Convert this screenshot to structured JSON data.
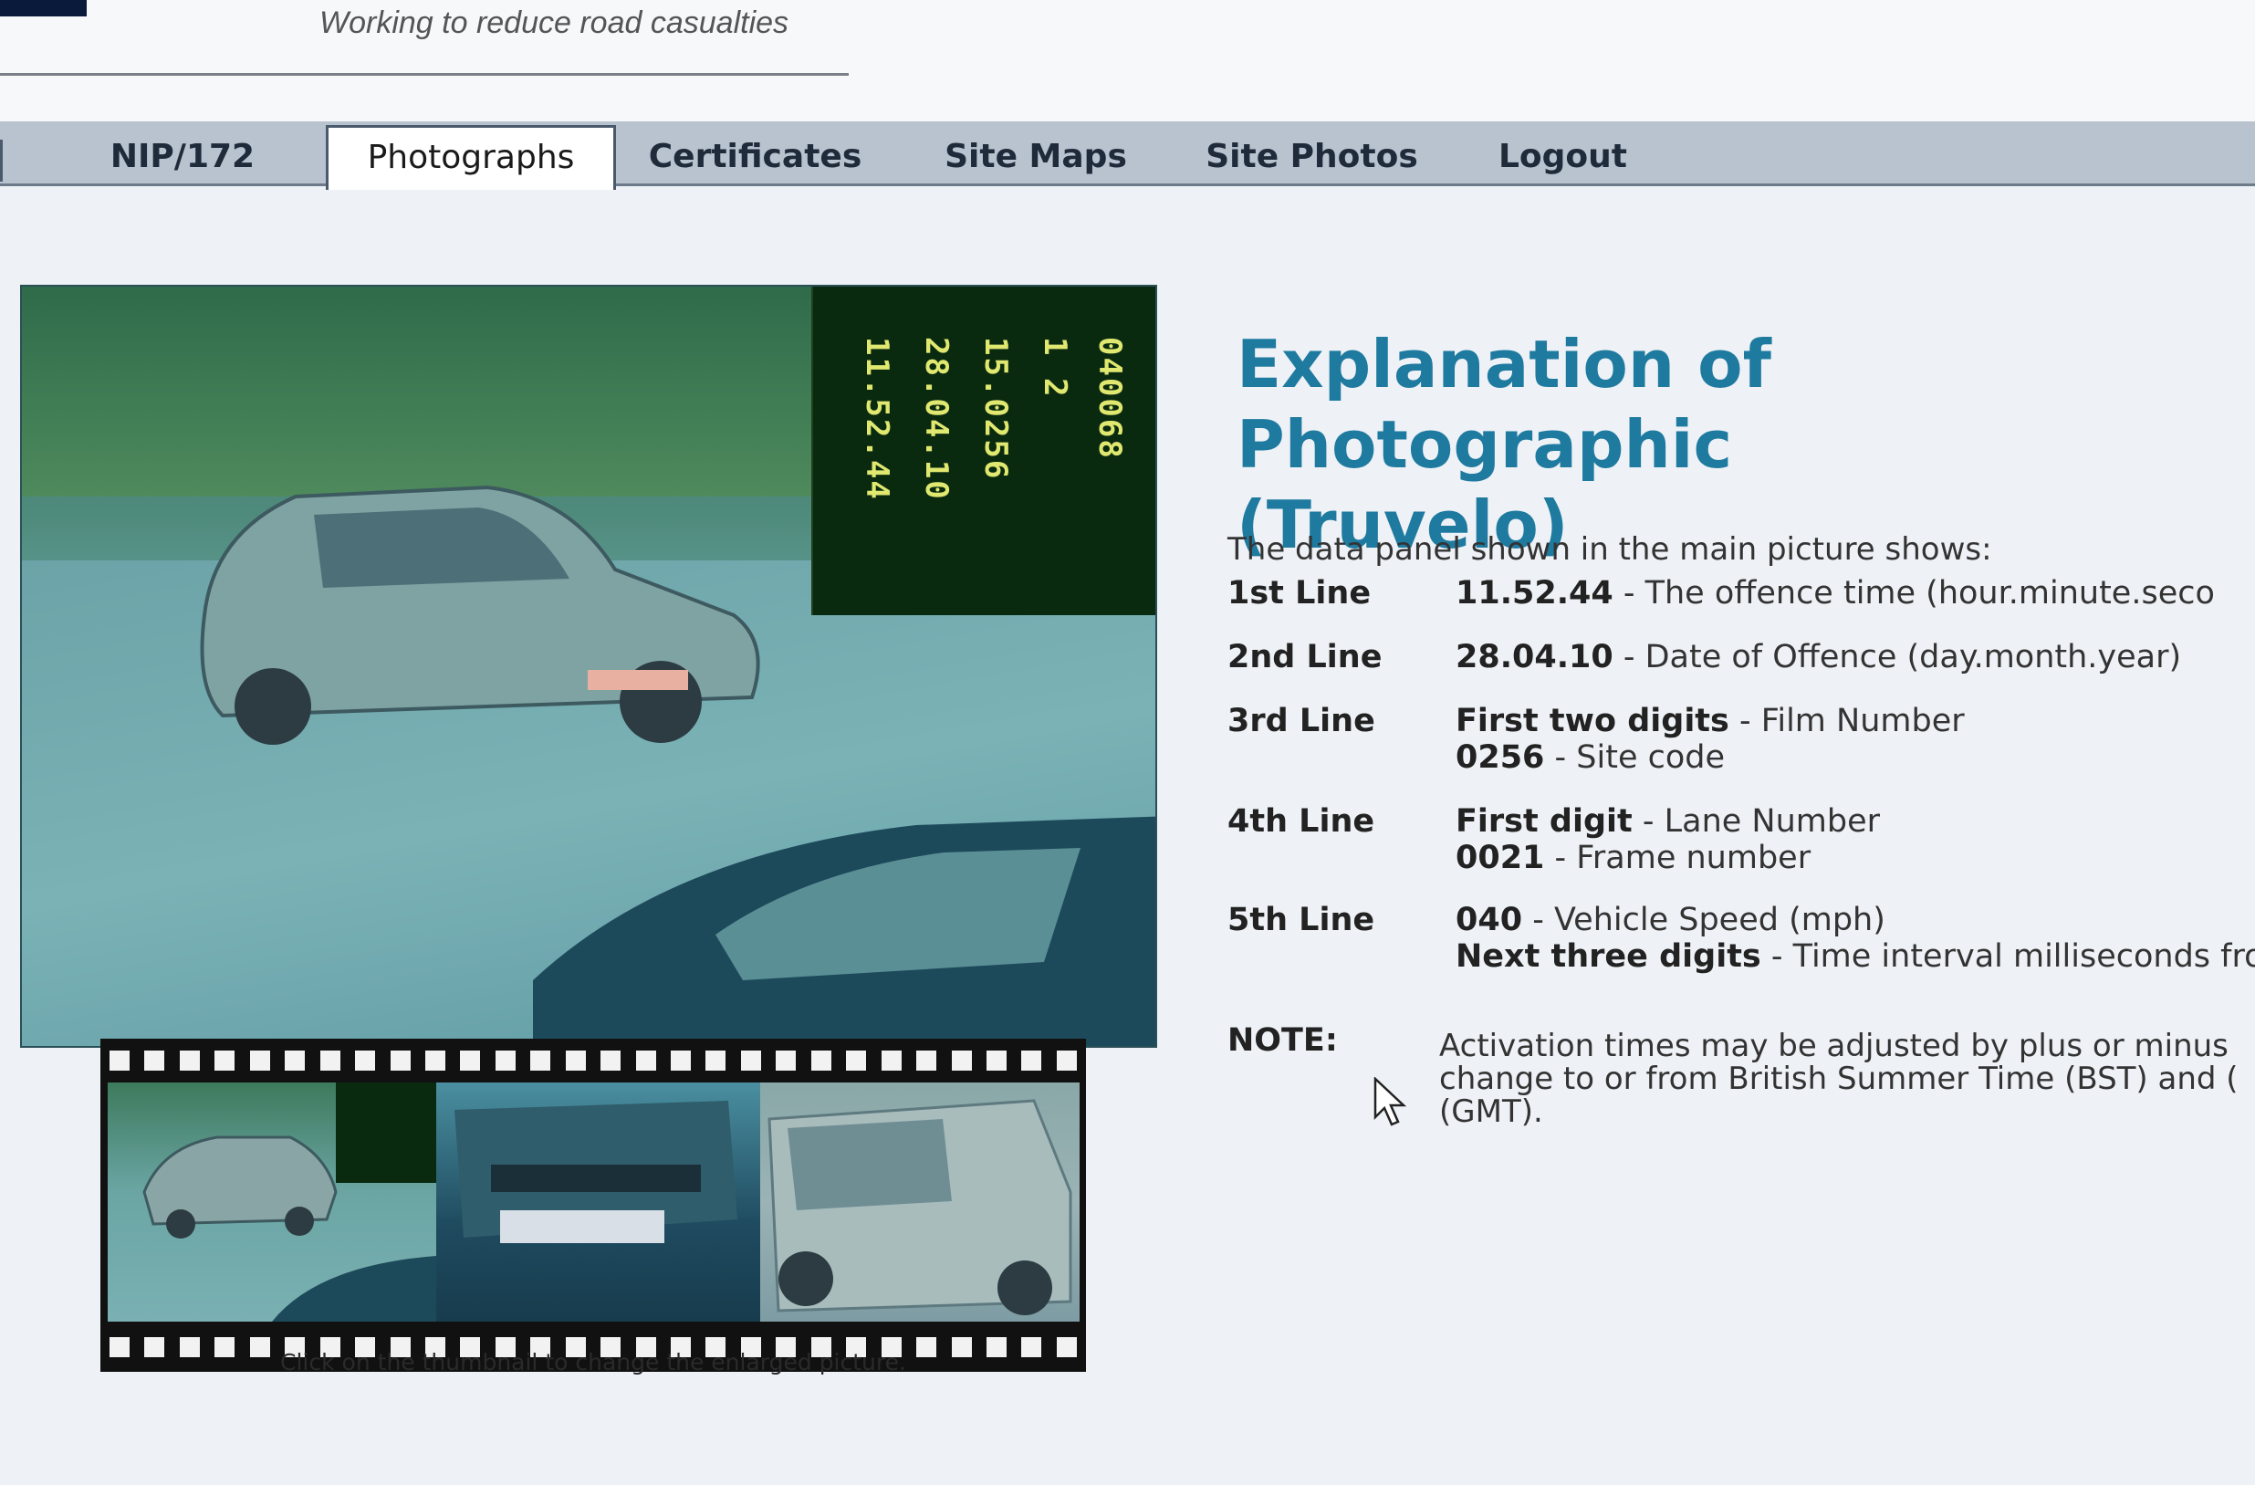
{
  "header": {
    "tagline": "Working to reduce road casualties"
  },
  "nav": {
    "tabs": [
      {
        "label": "NIP/172",
        "active": false
      },
      {
        "label": "Photographs",
        "active": true
      },
      {
        "label": "Certificates",
        "active": false
      },
      {
        "label": "Site Maps",
        "active": false
      },
      {
        "label": "Site Photos",
        "active": false
      },
      {
        "label": "Logout",
        "active": false
      }
    ]
  },
  "photo": {
    "data_panel_lines": [
      "11.52.44",
      "28.04.10",
      "15.0256",
      "1  2",
      "040068"
    ],
    "caption": "Click on the thumbnail to change the enlarged picture."
  },
  "explanation": {
    "title": "Explanation of Photographic\n(Truvelo)",
    "intro": "The data panel shown in the main picture shows:",
    "lines": [
      {
        "label": "1st Line",
        "parts": [
          {
            "bold": "11.52.44",
            "text": " - The offence time (hour.minute.seco"
          }
        ]
      },
      {
        "label": "2nd Line",
        "parts": [
          {
            "bold": "28.04.10",
            "text": " - Date of Offence (day.month.year)"
          }
        ]
      },
      {
        "label": "3rd Line",
        "parts": [
          {
            "bold": "First two digits",
            "text": " - Film Number"
          },
          {
            "bold": "0256",
            "text": " - Site code"
          }
        ]
      },
      {
        "label": "4th Line",
        "parts": [
          {
            "bold": "First digit",
            "text": " - Lane Number"
          },
          {
            "bold": "0021",
            "text": " - Frame number"
          }
        ]
      },
      {
        "label": "5th Line",
        "parts": [
          {
            "bold": "040",
            "text": " - Vehicle Speed (mph)"
          },
          {
            "bold": "Next three digits",
            "text": " - Time interval milliseconds from"
          }
        ]
      }
    ],
    "note_label": "NOTE:",
    "note_text": "Activation times may be adjusted by plus or minus change to or from British Summer Time (BST) and ( (GMT)."
  },
  "colors": {
    "title": "#1f7aa0",
    "nav_bg": "#b9c3cf",
    "panel_text": "#e0e870"
  }
}
